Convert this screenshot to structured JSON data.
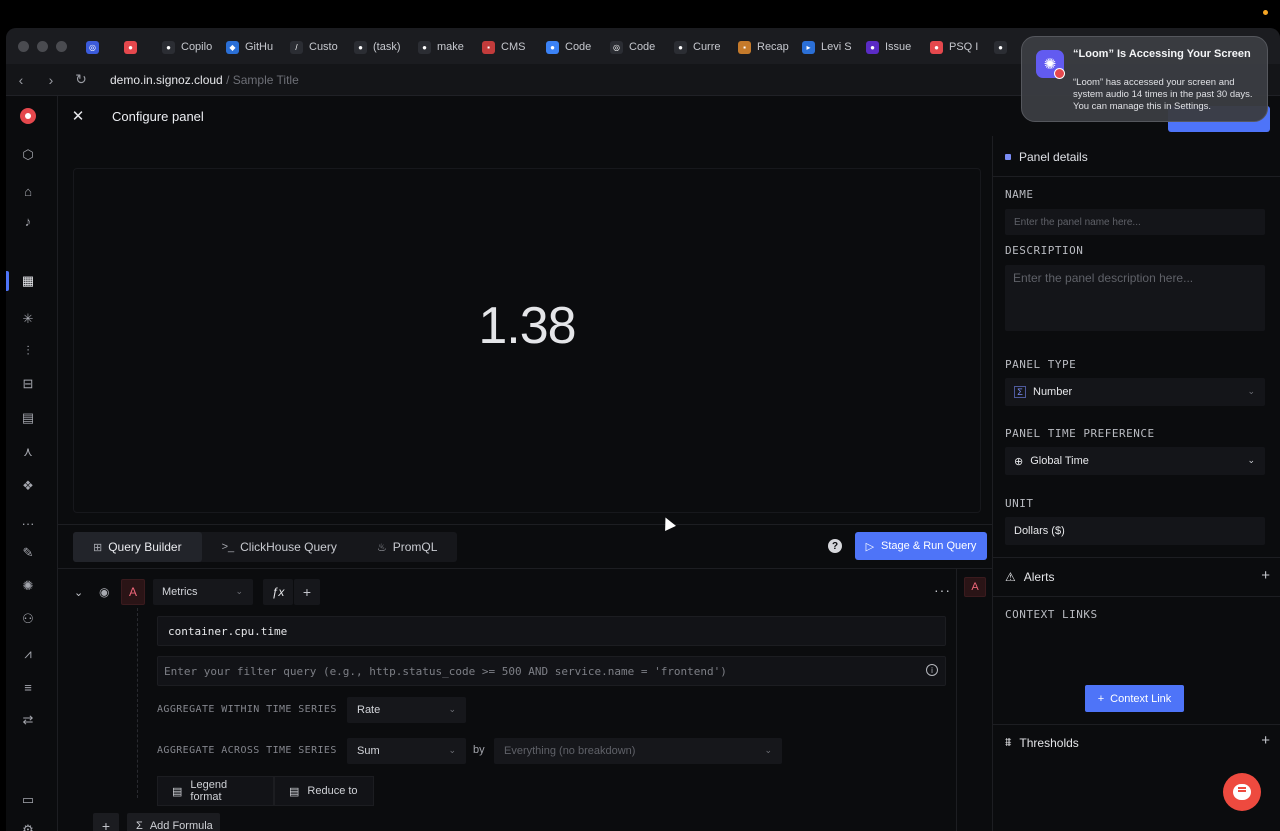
{
  "browser": {
    "tabs": [
      {
        "label": "Copilo",
        "color": "#2b2d33",
        "glyph": "●"
      },
      {
        "label": "GitHu",
        "color": "#2b6fd6",
        "glyph": "◆"
      },
      {
        "label": "Custo",
        "color": "#2b2d33",
        "glyph": "/"
      },
      {
        "label": "(task)",
        "color": "#2b2d33",
        "glyph": "●"
      },
      {
        "label": "make",
        "color": "#2b2d33",
        "glyph": "●"
      },
      {
        "label": "CMS",
        "color": "#c23b3b",
        "glyph": "▪"
      },
      {
        "label": "Code",
        "color": "#3b82f6",
        "glyph": "●"
      },
      {
        "label": "Code",
        "color": "#2b2d33",
        "glyph": "◎"
      },
      {
        "label": "Curre",
        "color": "#2b2d33",
        "glyph": "●"
      },
      {
        "label": "Recap",
        "color": "#c57a2b",
        "glyph": "▪"
      },
      {
        "label": "Levi S",
        "color": "#2b6fd6",
        "glyph": "▸"
      },
      {
        "label": "Issue",
        "color": "#5a2bc5",
        "glyph": "●"
      },
      {
        "label": "PSQ I",
        "color": "#e5484d",
        "glyph": "●"
      },
      {
        "label": "",
        "color": "#2b2d33",
        "glyph": "●"
      }
    ],
    "first_tabs": [
      {
        "color": "#3b5bdb",
        "glyph": "◎"
      },
      {
        "color": "#e5484d",
        "glyph": "●"
      }
    ],
    "url_host": "demo.in.signoz.cloud",
    "url_path": " / Sample Title"
  },
  "header": {
    "title": "Configure panel"
  },
  "preview": {
    "value": "1.38"
  },
  "query_tabs": {
    "query_builder": "Query Builder",
    "clickhouse": "ClickHouse Query",
    "promql": "PromQL"
  },
  "run_button": "Stage & Run Query",
  "query": {
    "letter": "A",
    "data_source": "Metrics",
    "fx": "ƒx",
    "metric": "container.cpu.time",
    "filter_placeholder": "Enter your filter query (e.g., http.status_code >= 500 AND service.name = 'frontend')",
    "aggregate_within_label": "AGGREGATE WITHIN TIME SERIES",
    "aggregate_within_value": "Rate",
    "aggregate_across_label": "AGGREGATE ACROSS TIME SERIES",
    "aggregate_across_value": "Sum",
    "by_label": "by",
    "group_by_placeholder": "Everything (no breakdown)",
    "legend_format": "Legend format",
    "reduce_to": "Reduce to",
    "add_formula": "Add Formula"
  },
  "panel": {
    "details_title": "Panel details",
    "name_label": "NAME",
    "name_placeholder": "Enter the panel name here...",
    "description_label": "DESCRIPTION",
    "description_placeholder": "Enter the panel description here...",
    "panel_type_label": "PANEL TYPE",
    "panel_type_value": "Number",
    "time_pref_label": "PANEL TIME PREFERENCE",
    "time_pref_value": "Global Time",
    "unit_label": "UNIT",
    "unit_value": "Dollars ($)",
    "alerts_label": "Alerts",
    "context_links_label": "CONTEXT LINKS",
    "context_link_button": "Context Link",
    "thresholds_label": "Thresholds"
  },
  "notification": {
    "title": "“Loom” Is Accessing Your Screen",
    "body": "“Loom” has accessed your screen and system audio 14 times in the past 30 days. You can manage this in Settings."
  },
  "colors": {
    "accent": "#4e74f8",
    "query_letter": "#f0677a",
    "brand": "#e5484d"
  }
}
